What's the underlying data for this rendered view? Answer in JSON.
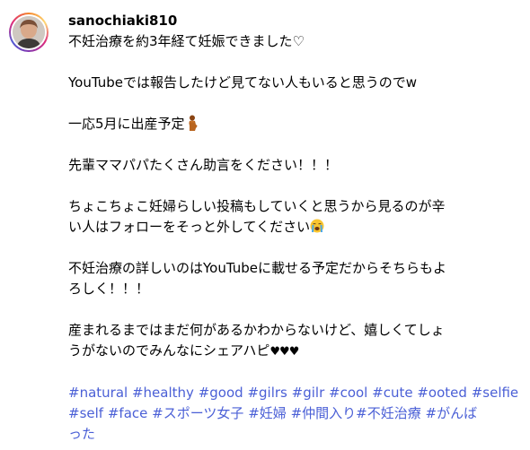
{
  "post": {
    "username": "sanochiaki810",
    "lines": {
      "l1": "不妊治療を約3年経て妊娠できました♡",
      "l2": "YouTubeでは報告したけど見てない人もいると思うのでw",
      "l3": "一応5月に出産予定",
      "l4": "先輩ママパパたくさん助言をください！！！",
      "l5a": "ちょこちょこ妊婦らしい投稿もしていくと思うから見るのが辛",
      "l5b": "い人はフォローをそっと外してください",
      "l6a": "不妊治療の詳しいのはYouTubeに載せる予定だからそちらもよ",
      "l6b": "ろしく！！！",
      "l7a": "産まれるまではまだ何があるかわからないけど、嬉しくてしょ",
      "l7b": "うがないのでみんなにシェアハピ",
      "hearts": "♥♥♥"
    },
    "emoji": {
      "pregnant": "pregnant-woman-emoji",
      "crying": "loudly-crying-face-emoji"
    },
    "hashtags": {
      "row1": [
        "#natural",
        "#healthy",
        "#good",
        "#gilrs",
        "#gilr",
        "#cool",
        "#cute",
        "#ooted",
        "#selfie"
      ],
      "row2": [
        "#self",
        "#face",
        "#スポーツ女子",
        "#妊婦",
        "#仲間入り",
        "#不妊治療",
        "#がんば"
      ],
      "row3": [
        "った"
      ]
    },
    "colors": {
      "hashtag": "#4a5fd6",
      "text": "#000000",
      "background": "#ffffff"
    }
  }
}
